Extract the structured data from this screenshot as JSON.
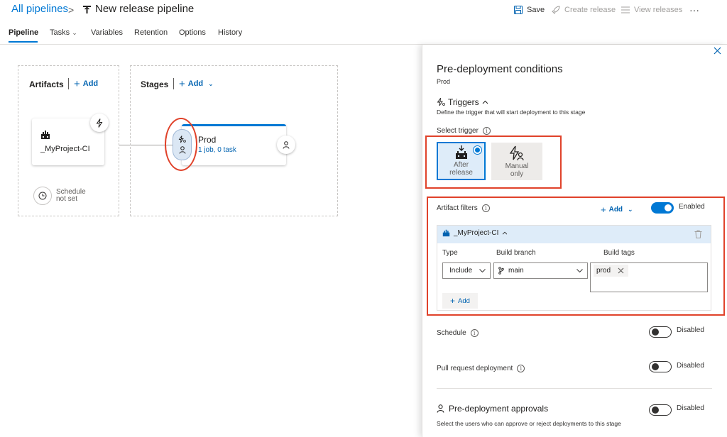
{
  "header": {
    "breadcrumb": "All pipelines",
    "separator": ">",
    "title": "New release pipeline",
    "actions": {
      "save": "Save",
      "create_release": "Create release",
      "view_releases": "View releases",
      "more": "···"
    }
  },
  "tabs": [
    {
      "label": "Pipeline",
      "active": true
    },
    {
      "label": "Tasks",
      "has_dropdown": true
    },
    {
      "label": "Variables"
    },
    {
      "label": "Retention"
    },
    {
      "label": "Options"
    },
    {
      "label": "History"
    }
  ],
  "canvas": {
    "artifacts": {
      "heading": "Artifacts",
      "add_label": "Add",
      "artifact_name": "_MyProject-CI",
      "schedule_label": "Schedule",
      "schedule_value": "not set"
    },
    "stages": {
      "heading": "Stages",
      "add_label": "Add",
      "stage_name": "Prod",
      "stage_summary": "1 job, 0 task"
    }
  },
  "panel": {
    "title": "Pre-deployment conditions",
    "subtitle": "Prod",
    "triggers": {
      "heading": "Triggers",
      "description": "Define the trigger that will start deployment to this stage",
      "select_label": "Select trigger",
      "options": [
        {
          "line1": "After",
          "line2": "release",
          "selected": true
        },
        {
          "line1": "Manual",
          "line2": "only",
          "selected": false
        }
      ]
    },
    "artifact_filters": {
      "label": "Artifact filters",
      "add_label": "Add",
      "toggle_state": "Enabled",
      "enabled": true,
      "artifact_name": "_MyProject-CI",
      "columns": [
        "Type",
        "Build branch",
        "Build tags"
      ],
      "row": {
        "type": "Include",
        "branch": "main",
        "tag": "prod"
      },
      "add_row_label": "Add"
    },
    "schedule": {
      "label": "Schedule",
      "state": "Disabled"
    },
    "pull_request": {
      "label": "Pull request deployment",
      "state": "Disabled"
    },
    "approvals": {
      "label": "Pre-deployment approvals",
      "state": "Disabled",
      "description": "Select the users who can approve or reject deployments to this stage"
    }
  },
  "colors": {
    "accent": "#0078d4",
    "link": "#0063b1",
    "highlight_red": "#e0422a"
  }
}
